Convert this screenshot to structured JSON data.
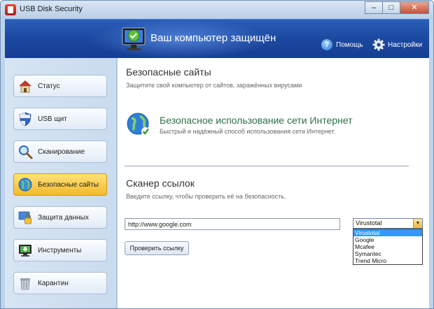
{
  "window": {
    "title": "USB Disk Security",
    "minimize": "–",
    "maximize": "□",
    "close": "✕"
  },
  "header": {
    "title": "Ваш компьютер защищён",
    "help_label": "Помощь",
    "settings_label": "Настройки"
  },
  "sidebar": {
    "items": [
      {
        "label": "Статус",
        "icon": "house-icon",
        "active": false
      },
      {
        "label": "USB щит",
        "icon": "shield-icon",
        "active": false
      },
      {
        "label": "Сканирование",
        "icon": "magnifier-icon",
        "active": false
      },
      {
        "label": "Безопасные сайты",
        "icon": "globe-icon",
        "active": true
      },
      {
        "label": "Защита данных",
        "icon": "lock-icon",
        "active": false
      },
      {
        "label": "Инструменты",
        "icon": "monitor-tools-icon",
        "active": false
      },
      {
        "label": "Карантин",
        "icon": "trash-bin-icon",
        "active": false
      }
    ]
  },
  "main": {
    "section_title": "Безопасные сайты",
    "section_subtitle": "Защитите свой компьютер от сайтов, заражённых вирусами",
    "feature_title": "Безопасное использование сети Интернет",
    "feature_subtitle": "Быстрый и надёжный способ использования сети Интернет.",
    "scanner_title": "Сканер ссылок",
    "scanner_subtitle": "Введите ссылку, чтобы проверить её на безопасность.",
    "url_value": "http://www.google.com",
    "check_button": "Проверить ссылку",
    "engine_selected": "Virustotal",
    "engine_options": [
      "Virustotal",
      "Google",
      "Mcafee",
      "Symantec",
      "Trend Micro"
    ]
  },
  "colors": {
    "header_blue": "#1c4aa2",
    "active_nav": "#f4b92a",
    "feature_green": "#2f6f4a",
    "selection_blue": "#3399ff"
  }
}
